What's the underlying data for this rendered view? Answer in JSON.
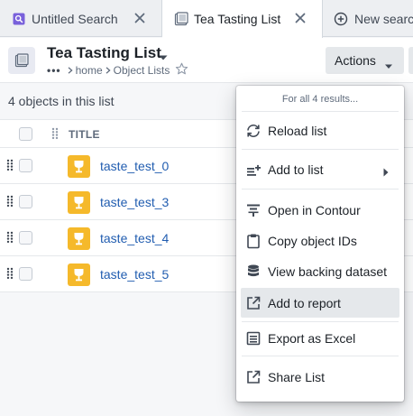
{
  "tabs": [
    {
      "label": "Untitled Search",
      "icon": "search-doc-icon"
    },
    {
      "label": "Tea Tasting List",
      "icon": "object-list-icon",
      "active": true
    },
    {
      "label": "New search",
      "icon": "plus-circle-icon"
    }
  ],
  "header": {
    "title": "Tea Tasting List",
    "breadcrumb": {
      "dots": "•••",
      "items": [
        "home",
        "Object Lists"
      ]
    },
    "actions_label": "Actions"
  },
  "list": {
    "count_text": "4 objects in this list",
    "column_title": "TITLE",
    "rows": [
      {
        "name": "taste_test_0"
      },
      {
        "name": "taste_test_3"
      },
      {
        "name": "taste_test_4"
      },
      {
        "name": "taste_test_5"
      }
    ],
    "type_icon_color": "#f5b92b",
    "link_color": "#215db0"
  },
  "menu": {
    "header": "For all 4 results...",
    "items": [
      {
        "label": "Reload list",
        "icon": "refresh-icon"
      },
      {
        "label": "Add to list",
        "icon": "add-to-list-icon",
        "submenu": true
      },
      {
        "label": "Open in Contour",
        "icon": "contour-icon"
      },
      {
        "label": "Copy object IDs",
        "icon": "clipboard-icon"
      },
      {
        "label": "View backing dataset",
        "icon": "database-icon"
      },
      {
        "label": "Add to report",
        "icon": "export-icon",
        "hovered": true
      },
      {
        "label": "Export as Excel",
        "icon": "excel-icon"
      },
      {
        "label": "Share List",
        "icon": "share-icon"
      }
    ]
  }
}
